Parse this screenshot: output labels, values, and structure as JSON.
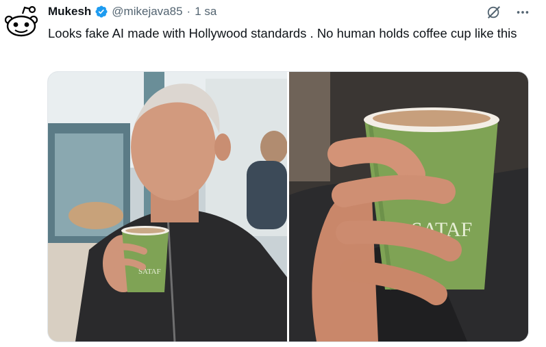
{
  "tweet": {
    "display_name": "Mukesh",
    "handle": "@mikejava85",
    "separator": "·",
    "time": "1 sa",
    "text": "Looks fake AI made with Hollywood standards . No human holds coffee cup like this",
    "cup_brand": "SATAF"
  },
  "colors": {
    "verified": "#1d9bf0",
    "text": "#0f1419",
    "muted": "#536471",
    "cup_green": "#7fa355"
  },
  "icons": {
    "avatar": "reddit-alien-avatar",
    "verified": "verified-badge-icon",
    "grok": "grok-icon",
    "more": "more-icon"
  }
}
